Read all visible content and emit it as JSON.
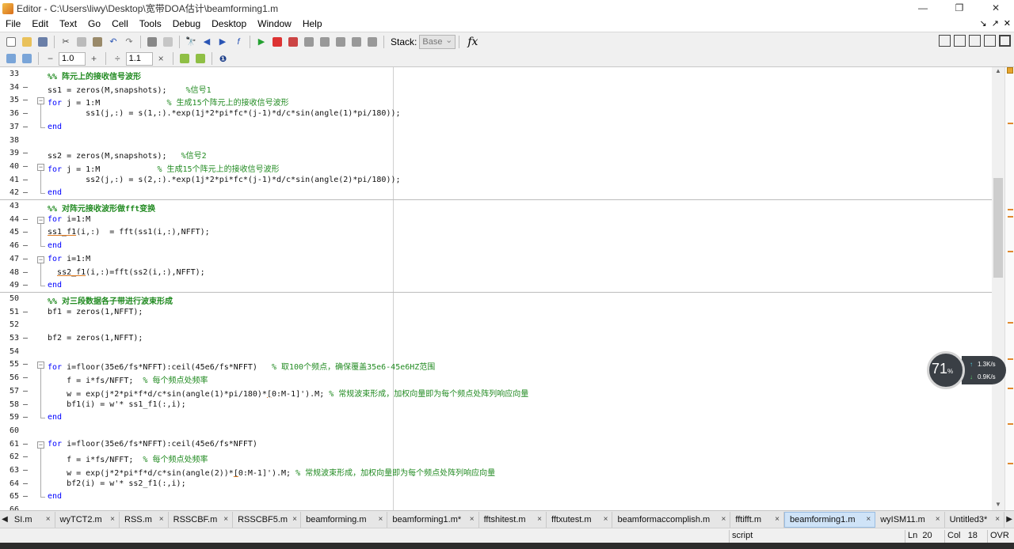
{
  "window": {
    "title": "Editor - C:\\Users\\liwy\\Desktop\\宽带DOA估计\\beamforming1.m",
    "minimize": "—",
    "maximize": "❐",
    "close": "✕"
  },
  "menu": [
    "File",
    "Edit",
    "Text",
    "Go",
    "Cell",
    "Tools",
    "Debug",
    "Desktop",
    "Window",
    "Help"
  ],
  "menu_right_controls": [
    "↘",
    "↗",
    "✕"
  ],
  "toolbar": {
    "stack_label": "Stack:",
    "stack_value": "Base",
    "fx_label": "fx"
  },
  "cell_toolbar": {
    "minus": "−",
    "value1": "1.0",
    "plus": "+",
    "divide": "÷",
    "value2": "1.1",
    "times": "×"
  },
  "editor": {
    "lines": [
      {
        "n": "33",
        "dash": "",
        "html": "<span class='cell'>%% 阵元上的接收信号波形</span>"
      },
      {
        "n": "34",
        "dash": "—",
        "html": "ss1 = zeros(M,snapshots);    <span class='cm'>%信号1</span>"
      },
      {
        "n": "35",
        "dash": "—",
        "fold": "−",
        "html": "<span class='kw'>for</span> j = 1:M              <span class='cm'>% 生成15个阵元上的接收信号波形</span>"
      },
      {
        "n": "36",
        "dash": "—",
        "html": "        ss1(j,:) = s(1,:).*exp(1j*2*pi*fc*(j-1)*d/c*sin(angle(1)*pi/180));"
      },
      {
        "n": "37",
        "dash": "—",
        "foldend": true,
        "html": "<span class='kw'>end</span>"
      },
      {
        "n": "38",
        "dash": "",
        "html": ""
      },
      {
        "n": "39",
        "dash": "—",
        "html": "ss2 = zeros(M,snapshots);   <span class='cm'>%信号2</span>"
      },
      {
        "n": "40",
        "dash": "—",
        "fold": "−",
        "html": "<span class='kw'>for</span> j = 1:M            <span class='cm'>% 生成15个阵元上的接收信号波形</span>"
      },
      {
        "n": "41",
        "dash": "—",
        "html": "        ss2(j,:) = s(2,:).*exp(1j*2*pi*fc*(j-1)*d/c*sin(angle(2)*pi/180));"
      },
      {
        "n": "42",
        "dash": "—",
        "foldend": true,
        "html": "<span class='kw'>end</span>"
      },
      {
        "n": "43",
        "dash": "",
        "divider": true,
        "html": "<span class='cell'>%% 对阵元接收波形做fft变换</span>"
      },
      {
        "n": "44",
        "dash": "—",
        "fold": "−",
        "html": "<span class='kw'>for</span> i=1:M"
      },
      {
        "n": "45",
        "dash": "—",
        "html": "<span class='warn'>ss1_f1</span>(i,:)  = fft(ss1(i,:),NFFT);"
      },
      {
        "n": "46",
        "dash": "—",
        "foldend": true,
        "html": "<span class='kw'>end</span>"
      },
      {
        "n": "47",
        "dash": "—",
        "fold": "−",
        "html": "<span class='kw'>for</span> i=1:M"
      },
      {
        "n": "48",
        "dash": "—",
        "html": "  <span class='warn'>ss2_f1</span>(i,:)=fft(ss2(i,:),NFFT);"
      },
      {
        "n": "49",
        "dash": "—",
        "foldend": true,
        "html": "<span class='kw'>end</span>"
      },
      {
        "n": "50",
        "dash": "",
        "divider": true,
        "html": "<span class='cell'>%% 对三段数据各子带进行波束形成</span>"
      },
      {
        "n": "51",
        "dash": "—",
        "html": "bf1 = zeros(1,NFFT);"
      },
      {
        "n": "52",
        "dash": "",
        "html": ""
      },
      {
        "n": "53",
        "dash": "—",
        "html": "bf2 = zeros(1,NFFT);"
      },
      {
        "n": "54",
        "dash": "",
        "html": ""
      },
      {
        "n": "55",
        "dash": "—",
        "fold": "−",
        "html": "<span class='kw'>for</span> i=floor(35e6/fs*NFFT):ceil(45e6/fs*NFFT)   <span class='cm'>% 取100个频点，确保覆盖35e6-45e6HZ范围</span>"
      },
      {
        "n": "56",
        "dash": "—",
        "html": "    f = i*fs/NFFT;  <span class='cm'>% 每个频点处频率</span>"
      },
      {
        "n": "57",
        "dash": "—",
        "html": "    w = exp(j*2*pi*f*d/c*sin(angle(1)*pi/180)*<span class='warn'>[</span>0:M-1]').M; <span class='cm'>% 常规波束形成，加权向量即为每个频点处阵列响应向量</span>"
      },
      {
        "n": "58",
        "dash": "—",
        "html": "    bf1(i) = w'* ss1_f1(:,i);"
      },
      {
        "n": "59",
        "dash": "—",
        "foldend": true,
        "html": "<span class='kw'>end</span>"
      },
      {
        "n": "60",
        "dash": "",
        "html": ""
      },
      {
        "n": "61",
        "dash": "—",
        "fold": "−",
        "html": "<span class='kw'>for</span> i=floor(35e6/fs*NFFT):ceil(45e6/fs*NFFT)"
      },
      {
        "n": "62",
        "dash": "—",
        "html": "    f = i*fs/NFFT;  <span class='cm'>% 每个频点处频率</span>"
      },
      {
        "n": "63",
        "dash": "—",
        "html": "    w = exp(j*2*pi*f*d/c*sin(angle(2))*<span class='warn'>[</span>0:M-1]').M; <span class='cm'>% 常规波束形成，加权向量即为每个频点处阵列响应向量</span>"
      },
      {
        "n": "64",
        "dash": "—",
        "html": "    bf2(i) = w'* ss2_f1(:,i);"
      },
      {
        "n": "65",
        "dash": "—",
        "foldend": true,
        "html": "<span class='kw'>end</span>"
      },
      {
        "n": "66",
        "dash": "",
        "html": ""
      }
    ]
  },
  "net_widget": {
    "percent": "71",
    "percent_unit": "%",
    "up_arrow": "↑",
    "up": "1.3K/s",
    "down_arrow": "↓",
    "down": "0.9K/s"
  },
  "tabs": [
    {
      "label": "SI.m",
      "width": 58
    },
    {
      "label": "wyTCT2.m",
      "width": 82
    },
    {
      "label": "RSS.m",
      "width": 62
    },
    {
      "label": "RSSCBF.m",
      "width": 82
    },
    {
      "label": "RSSCBF5.m",
      "width": 86
    },
    {
      "label": "beamforming.m",
      "width": 110
    },
    {
      "label": "beamforming1.m*",
      "width": 116
    },
    {
      "label": "fftshitest.m",
      "width": 86
    },
    {
      "label": "fftxutest.m",
      "width": 84
    },
    {
      "label": "beamformaccomplish.m",
      "width": 150
    },
    {
      "label": "fftifft.m",
      "width": 68
    },
    {
      "label": "beamforming1.m",
      "width": 116,
      "active": true
    },
    {
      "label": "wyISM11.m",
      "width": 88
    },
    {
      "label": "Untitled3*",
      "width": 76
    }
  ],
  "tab_arrows": {
    "left": "◀",
    "right": "▶"
  },
  "status": {
    "mode": "script",
    "ln_label": "Ln",
    "ln": "20",
    "col_label": "Col",
    "col": "18",
    "ovr": "OVR"
  }
}
